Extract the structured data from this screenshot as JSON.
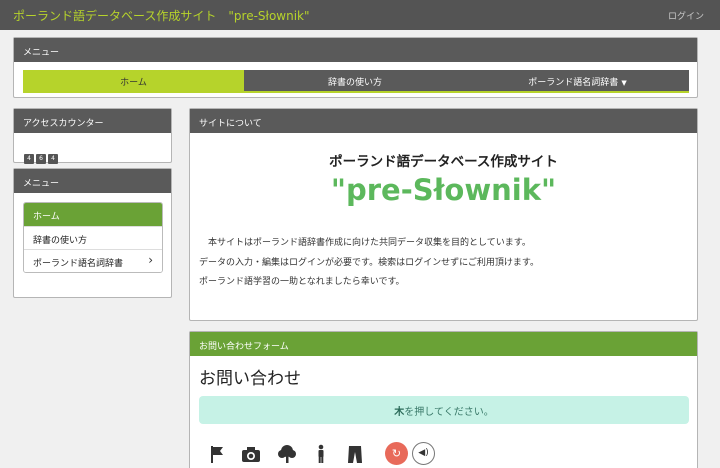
{
  "header": {
    "site_title": "ポーランド語データベース作成サイト　\"pre-Słownik\"",
    "login_label": "ログイン"
  },
  "top_menu": {
    "title": "メニュー",
    "tabs": [
      {
        "label": "ホーム",
        "active": true
      },
      {
        "label": "辞書の使い方",
        "active": false
      },
      {
        "label": "ポーランド語名詞辞書",
        "active": false,
        "dropdown": true
      }
    ]
  },
  "access_counter": {
    "title": "アクセスカウンター",
    "digits": [
      "4",
      "6",
      "4"
    ]
  },
  "side_menu": {
    "title": "メニュー",
    "items": [
      {
        "label": "ホーム",
        "active": true
      },
      {
        "label": "辞書の使い方",
        "active": false
      },
      {
        "label": "ポーランド語名詞辞書",
        "active": false,
        "submenu": true
      }
    ]
  },
  "about": {
    "panel_title": "サイトについて",
    "heading": "ポーランド語データベース作成サイト",
    "site_name": "\"pre-Słownik\"",
    "lines": [
      "　本サイトはポーランド語辞書作成に向けた共同データ収集を目的としています。",
      "データの入力・編集はログインが必要です。検索はログインせずにご利用頂けます。",
      "ポーランド語学習の一助となれましたら幸いです。"
    ]
  },
  "contact": {
    "panel_title": "お問い合わせフォーム",
    "title": "お問い合わせ",
    "hint_keyword": "木",
    "hint_rest": "を押してください。",
    "icons": [
      "flag-icon",
      "camera-icon",
      "tree-icon",
      "person-icon",
      "pants-icon"
    ],
    "reload_icon": "reload-icon",
    "sound_icon": "speaker-icon"
  },
  "colors": {
    "header_bg": "#545454",
    "brand_lime": "#b6d32b",
    "green": "#6aa236",
    "title_green": "#5cb85c",
    "hint_bg": "#c6f2e6"
  }
}
